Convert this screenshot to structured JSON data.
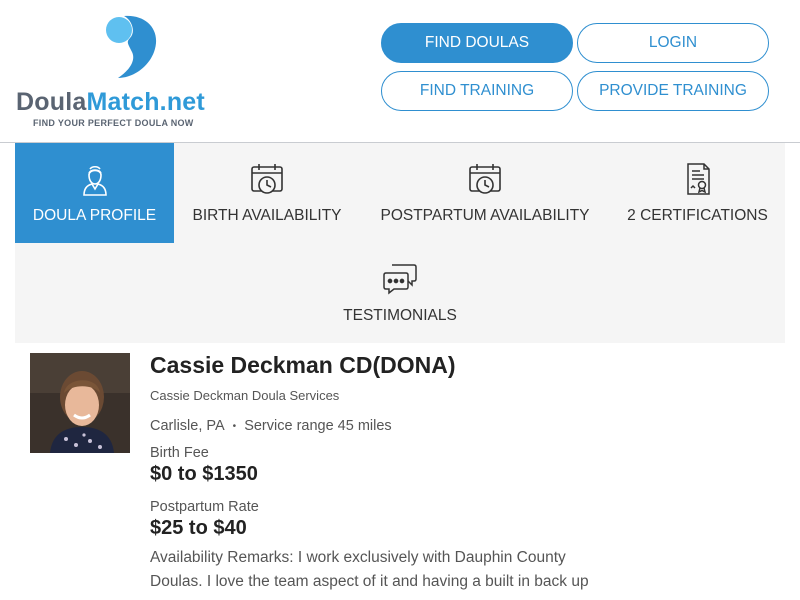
{
  "header": {
    "logo": {
      "name_part1": "Doula",
      "name_part2": "Match.net",
      "tagline": "FIND YOUR PERFECT DOULA NOW"
    },
    "nav": {
      "find_doulas": "FIND DOULAS",
      "login": "LOGIN",
      "find_training": "FIND TRAINING",
      "provide_training": "PROVIDE TRAINING"
    }
  },
  "tabs": [
    {
      "label": "DOULA PROFILE",
      "icon": "person-icon",
      "active": true
    },
    {
      "label": "BIRTH AVAILABILITY",
      "icon": "calendar-clock-icon",
      "active": false
    },
    {
      "label": "POSTPARTUM AVAILABILITY",
      "icon": "calendar-clock-icon",
      "active": false
    },
    {
      "label": "2 CERTIFICATIONS",
      "icon": "certificate-icon",
      "active": false
    },
    {
      "label": "TESTIMONIALS",
      "icon": "chat-bubbles-icon",
      "active": false
    }
  ],
  "profile": {
    "name": "Cassie Deckman CD(DONA)",
    "business": "Cassie Deckman Doula Services",
    "city": "Carlisle, PA",
    "separator": "•",
    "service_range": "Service range 45 miles",
    "birth_fee_label": "Birth Fee",
    "birth_fee": "$0 to $1350",
    "postpartum_label": "Postpartum Rate",
    "postpartum_rate": "$25 to $40",
    "remarks": "Availability Remarks: I work exclusively with Dauphin County Doulas. I love the team aspect of it and having a built in back up"
  },
  "colors": {
    "accent": "#2f8fd0",
    "tab_bg": "#f5f5f5",
    "logo_grey": "#5a6472",
    "logo_blue": "#2f9ad8"
  }
}
